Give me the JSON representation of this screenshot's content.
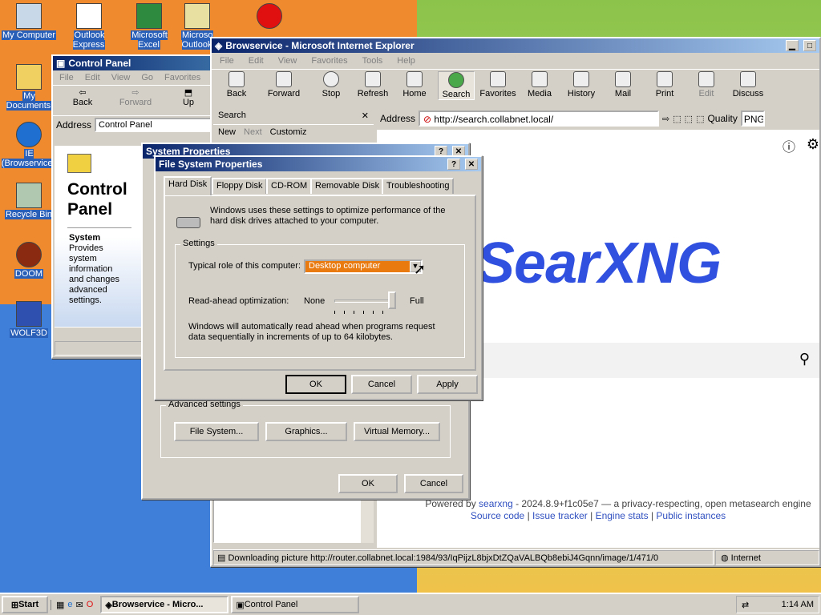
{
  "desktop": {
    "icons": [
      {
        "label": "My Computer",
        "icon": "computer-icon"
      },
      {
        "label": "Outlook Express",
        "icon": "outlook-icon"
      },
      {
        "label": "Microsoft Excel",
        "icon": "excel-icon"
      },
      {
        "label": "Microsoft Outlook",
        "icon": "outlook-icon"
      },
      {
        "label": "Opera",
        "icon": "opera-icon"
      },
      {
        "label": "My Documents",
        "icon": "folder-icon"
      },
      {
        "label": "IE (Browservice)",
        "icon": "ie-icon"
      },
      {
        "label": "Recycle Bin",
        "icon": "recycle-bin-icon"
      },
      {
        "label": "DOOM",
        "icon": "doom-icon"
      },
      {
        "label": "WOLF3D",
        "icon": "wolf3d-icon"
      }
    ]
  },
  "control_panel": {
    "title": "Control Panel",
    "menu": [
      "File",
      "Edit",
      "View",
      "Go",
      "Favorites"
    ],
    "toolbar": {
      "back": "Back",
      "forward": "Forward",
      "up": "Up"
    },
    "address_label": "Address",
    "address_value": "Control Panel",
    "heading_line1": "Control",
    "heading_line2": "Panel",
    "item_title": "System",
    "item_desc": "Provides system information and changes advanced settings."
  },
  "ie": {
    "title": "Browservice - Microsoft Internet Explorer",
    "menu": [
      "File",
      "Edit",
      "View",
      "Favorites",
      "Tools",
      "Help"
    ],
    "toolbar": [
      "Back",
      "Forward",
      "Stop",
      "Refresh",
      "Home",
      "Search",
      "Favorites",
      "Media",
      "History",
      "Mail",
      "Print",
      "Edit",
      "Discuss"
    ],
    "search_pane_title": "Search",
    "search_new": "New",
    "search_next": "Next",
    "search_customize": "Customiz",
    "address_label": "Address",
    "url": "http://search.collabnet.local/",
    "quality_label": "Quality",
    "quality_value": "PNG",
    "logo": "SearXNG",
    "footer_line1_prefix": "Powered by ",
    "footer_link": "searxng",
    "footer_line1_suffix": " - 2024.8.9+f1c05e7 — a privacy-respecting, open metasearch engine",
    "footer_links": [
      "Source code",
      "Issue tracker",
      "Engine stats",
      "Public instances"
    ],
    "status_text": "Downloading picture http://router.collabnet.local:1984/93/IqPijzL8bjxDtZQaVALBQb8ebiJ4Gqnn/image/1/471/0",
    "status_zone": "Internet"
  },
  "system_props": {
    "title": "System Properties",
    "advanced_label": "Advanced settings",
    "file_system_btn": "File System...",
    "graphics_btn": "Graphics...",
    "virtual_memory_btn": "Virtual Memory...",
    "ok": "OK",
    "cancel": "Cancel"
  },
  "fs_props": {
    "title": "File System Properties",
    "tabs": [
      "Hard Disk",
      "Floppy Disk",
      "CD-ROM",
      "Removable Disk",
      "Troubleshooting"
    ],
    "intro": "Windows uses these settings to optimize performance of the hard disk drives attached to your computer.",
    "settings_label": "Settings",
    "role_label": "Typical role of this computer:",
    "role_value": "Desktop computer",
    "readahead_label": "Read-ahead optimization:",
    "slider_min": "None",
    "slider_max": "Full",
    "slider_level": 1.0,
    "readahead_desc": "Windows will automatically read ahead when programs request data sequentially in increments of up to 64 kilobytes.",
    "ok": "OK",
    "cancel": "Cancel",
    "apply": "Apply"
  },
  "taskbar": {
    "start": "Start",
    "tasks": [
      "Browservice - Micro...",
      "Control Panel"
    ],
    "clock": "1:14 AM"
  }
}
